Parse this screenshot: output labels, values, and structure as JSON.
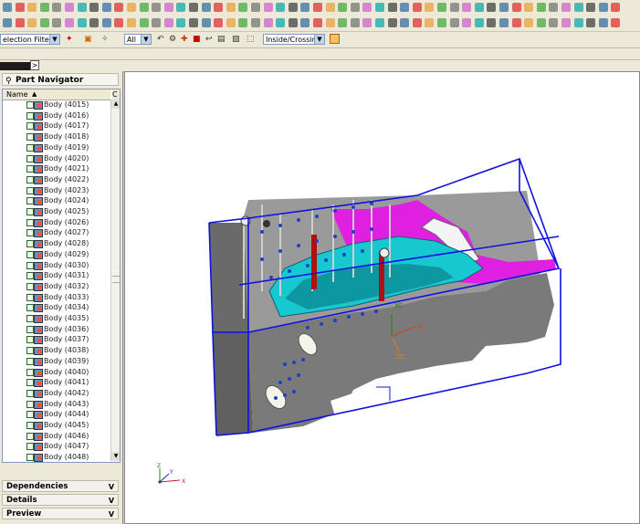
{
  "toolbar": {
    "row1_icons": [
      "new-icon",
      "open-icon",
      "save-icon",
      "cut-icon",
      "copy-icon",
      "paste-icon",
      "undo-icon",
      "redo-icon",
      "sketch-icon",
      "extrude-icon",
      "revolve-icon",
      "hole-icon",
      "boss-icon",
      "pocket-icon",
      "blend-icon",
      "chamfer-icon",
      "shell-icon",
      "mirror-icon",
      "pattern-icon",
      "trim-icon",
      "unite-icon",
      "subtract-icon",
      "intersect-icon",
      "offset-icon",
      "measure-icon",
      "analyze-icon",
      "render-icon",
      "layer-icon",
      "view-icon",
      "fit-icon",
      "zoom-icon",
      "rotate-icon",
      "pan-icon",
      "shade-icon",
      "wireframe-icon",
      "section-icon",
      "assembly-icon",
      "constraint-icon",
      "mate-icon",
      "explode-icon",
      "drafting-icon",
      "surface-icon",
      "curve-icon",
      "point-icon",
      "plane-icon",
      "axis-icon",
      "csys-icon",
      "datum-icon",
      "settings-icon",
      "help-icon"
    ],
    "row2_icons": [
      "line-icon",
      "arc-icon",
      "circle-icon",
      "spline-icon",
      "text-icon",
      "polygon-icon",
      "rectangle-icon",
      "ellipse-icon",
      "fillet-icon",
      "chamfer-icon",
      "trim-icon",
      "extend-icon",
      "dimension-icon",
      "constraint-icon",
      "project-icon",
      "offset-icon",
      "mirror-icon",
      "pattern-icon",
      "move-icon",
      "copy-icon",
      "scale-icon",
      "rotate-icon",
      "delete-icon",
      "hide-icon",
      "show-icon",
      "color-icon",
      "edit-icon",
      "point-icon",
      "plane-icon",
      "snap-icon",
      "grid-icon",
      "cut-icon",
      "gear-icon",
      "assembly-icon",
      "mold-icon",
      "cavity-icon",
      "core-icon",
      "parting-icon",
      "runner-icon",
      "gate-icon",
      "cooling-icon",
      "ejector-icon",
      "slider-icon",
      "lifter-icon",
      "insert-icon",
      "electrode-icon",
      "report-icon",
      "check-icon",
      "export-icon",
      "info-icon"
    ]
  },
  "filterbar": {
    "selection_filter": "election Filter",
    "scope": "All",
    "selection_mode": "Inside/Crossing"
  },
  "navigator": {
    "title": "Part Navigator",
    "column_name": "Name",
    "column_c": "C",
    "items": [
      {
        "label": "Body (4015)"
      },
      {
        "label": "Body (4016)"
      },
      {
        "label": "Body (4017)"
      },
      {
        "label": "Body (4018)"
      },
      {
        "label": "Body (4019)"
      },
      {
        "label": "Body (4020)"
      },
      {
        "label": "Body (4021)"
      },
      {
        "label": "Body (4022)"
      },
      {
        "label": "Body (4023)"
      },
      {
        "label": "Body (4024)"
      },
      {
        "label": "Body (4025)"
      },
      {
        "label": "Body (4026)"
      },
      {
        "label": "Body (4027)"
      },
      {
        "label": "Body (4028)"
      },
      {
        "label": "Body (4029)"
      },
      {
        "label": "Body (4030)"
      },
      {
        "label": "Body (4031)"
      },
      {
        "label": "Body (4032)"
      },
      {
        "label": "Body (4033)"
      },
      {
        "label": "Body (4034)"
      },
      {
        "label": "Body (4035)"
      },
      {
        "label": "Body (4036)"
      },
      {
        "label": "Body (4037)"
      },
      {
        "label": "Body (4038)"
      },
      {
        "label": "Body (4039)"
      },
      {
        "label": "Body (4040)"
      },
      {
        "label": "Body (4041)"
      },
      {
        "label": "Body (4042)"
      },
      {
        "label": "Body (4043)"
      },
      {
        "label": "Body (4044)"
      },
      {
        "label": "Body (4045)"
      },
      {
        "label": "Body (4046)"
      },
      {
        "label": "Body (4047)"
      },
      {
        "label": "Body (4048)"
      }
    ]
  },
  "panels": {
    "dependencies": "Dependencies",
    "details": "Details",
    "preview": "Preview"
  },
  "viewport": {
    "wcs_label_zc": "ZC",
    "wcs_label_yc": "YC",
    "wcs_label_xc": "XC",
    "triad_z": "Z",
    "triad_y": "Y",
    "triad_x": "X",
    "colors": {
      "box_edges": "#1010e0",
      "wall": "#7d7d7d",
      "magenta_part": "#e020e0",
      "cyan_part": "#18c8d0",
      "pins": "#2040c0"
    }
  }
}
